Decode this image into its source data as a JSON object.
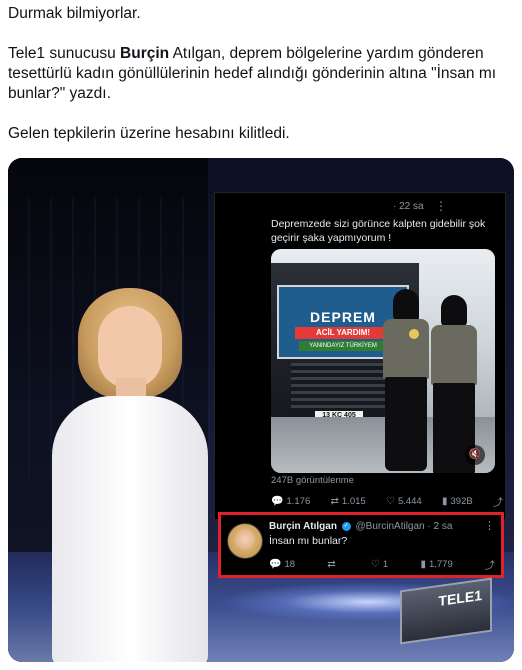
{
  "post": {
    "line1": "Durmak bilmiyorlar.",
    "line2_prefix": "Tele1 sunucusu ",
    "line2_bold": "Burçin",
    "line2_rest": " Atılgan, deprem bölgelerine yardım gönderen tesettürlü kadın gönüllülerinin hedef alındığı gönderinin altına \"İnsan mı bunlar?\" yazdı.",
    "line3": "Gelen tepkilerin üzerine hesabını kilitledi."
  },
  "embedded_tweet": {
    "time": "· 22 sa",
    "more": "⋮",
    "text": "Depremzede sizi görünce kalpten gidebilir şok geçirir şaka yapmıyorum !",
    "photo": {
      "banner_title": "DEPREM",
      "banner_sub": "ACİL YARDIM!",
      "banner_strip": "YANINDAYIZ TÜRKİYEM",
      "plate": "13 KC 405"
    },
    "views": "247B görüntülenme",
    "actions": {
      "replies": "1.176",
      "retweets": "1.015",
      "likes": "5.444",
      "views": "392B"
    }
  },
  "reply": {
    "name": "Burçin Atılgan",
    "handle": "@BurcinAtilgan · 2 sa",
    "more": "⋮",
    "text": "İnsan mı bunlar?",
    "actions": {
      "replies": "18",
      "retweets": "",
      "likes": "1",
      "views": "1.779"
    }
  },
  "overlay_logo": "TELE1",
  "colors": {
    "highlight": "#e0222a",
    "verified": "#1d9bf0",
    "banner": "#1f5d8f"
  },
  "icons": [
    "reply-icon",
    "retweet-icon",
    "like-icon",
    "views-icon",
    "share-icon",
    "mute-icon",
    "more-icon",
    "verified-icon"
  ]
}
